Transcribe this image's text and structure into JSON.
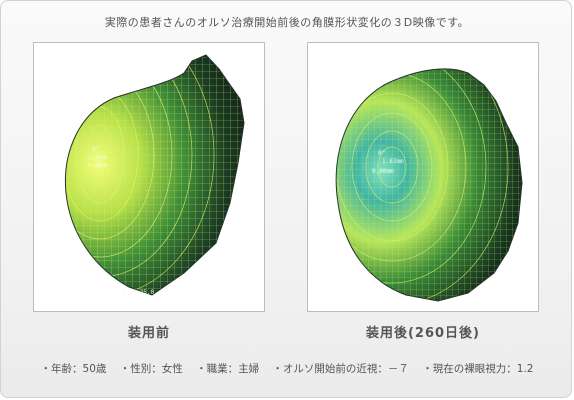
{
  "caption": "実際の患者さんのオルソ治療開始前後の角膜形状変化の３D映像です。",
  "before": {
    "label": "装用前",
    "overlay_lines": [
      "0°",
      "1.0mm",
      "0.0mm"
    ],
    "footer_text": "−1.60 25.0"
  },
  "after": {
    "label": "装用後(260日後)",
    "overlay_lines": [
      "0°",
      "1.83mm",
      "0.00mm"
    ]
  },
  "info": {
    "age": "・年齢：50歳",
    "gender": "・性別：女性",
    "job": "・職業：主婦",
    "myopia": "・オルソ開始前の近視：－７",
    "vision": "・現在の裸眼視力：1.2"
  },
  "colors": {
    "mesh_dark": "#0e1a14",
    "mesh_line_before": "#d8f060",
    "mesh_line_after": "#bfe85a",
    "center_after": "#3fb4a6",
    "text": "#555555"
  }
}
